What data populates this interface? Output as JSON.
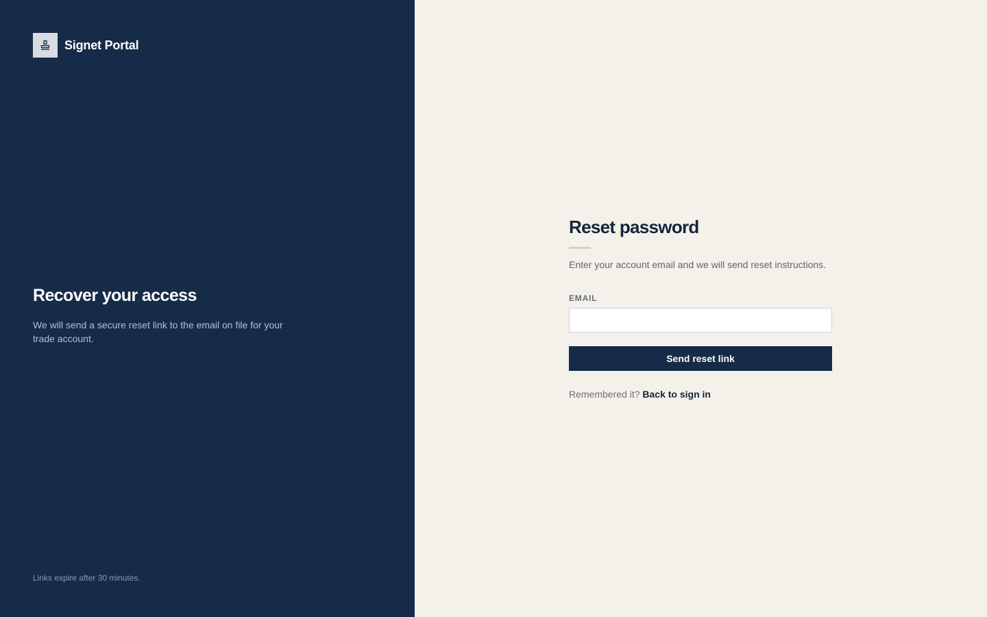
{
  "brand": {
    "name": "Signet Portal",
    "logo_icon": "stamp-icon",
    "hero_title": "Recover your access",
    "hero_text": "We will send a secure reset link to the email on file for your trade account.",
    "footer_note": "Links expire after 30 minutes.",
    "panel_color": "#162b48"
  },
  "form": {
    "title": "Reset password",
    "subtitle": "Enter your account email and we will send reset instructions.",
    "email_label": "EMAIL",
    "email_value": "",
    "email_placeholder": "",
    "submit_label": "Send reset link",
    "alt_prompt": "Remembered it?",
    "alt_link": "Back to sign in",
    "panel_color": "#f4f1ea"
  }
}
